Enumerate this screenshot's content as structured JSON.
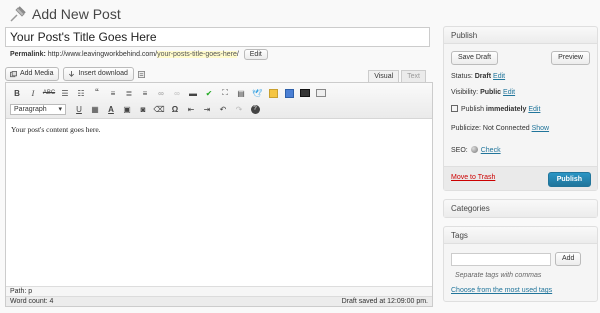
{
  "header": {
    "title": "Add New Post",
    "icon": "pushpin-icon"
  },
  "post": {
    "title": "Your Post's Title Goes Here",
    "permalink_label": "Permalink:",
    "permalink_base": "http://www.leavingworkbehind.com/",
    "permalink_slug": "your-posts-title-goes-here",
    "permalink_end": "/",
    "edit_label": "Edit"
  },
  "media": {
    "add_media_label": "Add Media",
    "insert_download_label": "Insert download"
  },
  "editor": {
    "tabs": [
      "Visual",
      "Text"
    ],
    "active_tab": "Visual",
    "format_select": "Paragraph",
    "content": "Your post's content goes here.",
    "path": "Path: p",
    "word_count": "Word count: 4",
    "draft_saved": "Draft saved at 12:09:00 pm."
  },
  "publish": {
    "title": "Publish",
    "save_draft_label": "Save Draft",
    "preview_label": "Preview",
    "status_label": "Status:",
    "status_value": "Draft",
    "visibility_label": "Visibility:",
    "visibility_value": "Public",
    "publish_label": "Publish",
    "publish_value": "immediately",
    "publicize_label": "Publicize: Not Connected",
    "show_label": "Show",
    "seo_label": "SEO:",
    "check_label": "Check",
    "edit_label": "Edit",
    "trash_label": "Move to Trash",
    "publish_button": "Publish"
  },
  "categories": {
    "title": "Categories"
  },
  "tags": {
    "title": "Tags",
    "add_label": "Add",
    "hint": "Separate tags with commas",
    "most_used_label": "Choose from the most used tags"
  },
  "colors": {
    "accent": "#21759b",
    "trash": "#cc0000",
    "slug_highlight": "#fffbcc"
  }
}
